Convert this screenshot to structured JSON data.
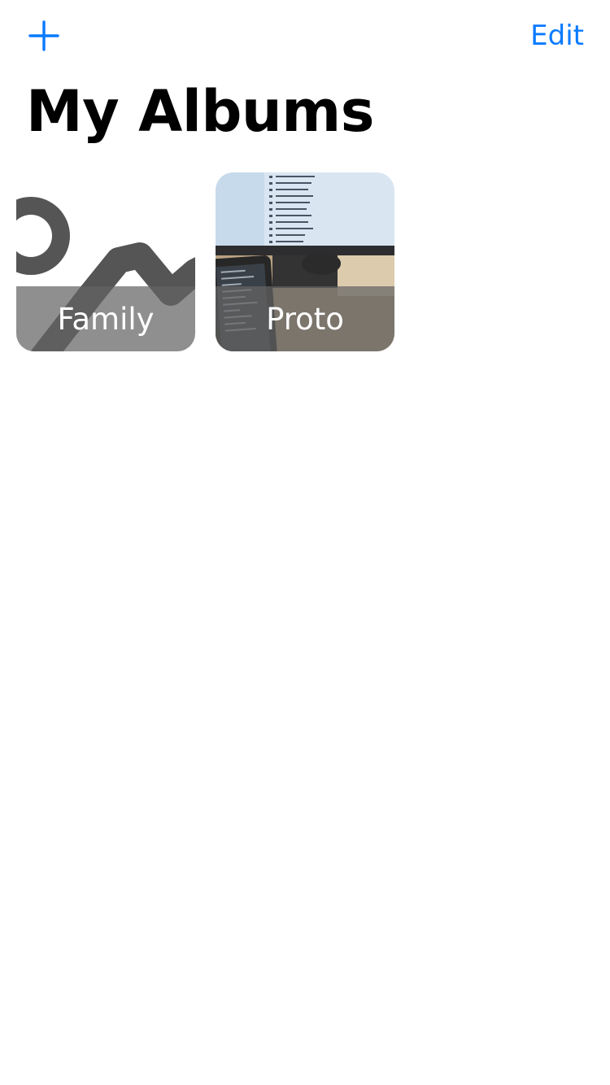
{
  "header": {
    "add_icon": "plus-icon",
    "edit_label": "Edit",
    "accent_color": "#0a7aff"
  },
  "title": "My Albums",
  "albums": [
    {
      "name": "Family",
      "thumbnail": "placeholder-photo-icon"
    },
    {
      "name": "Proto",
      "thumbnail": "photo"
    }
  ]
}
